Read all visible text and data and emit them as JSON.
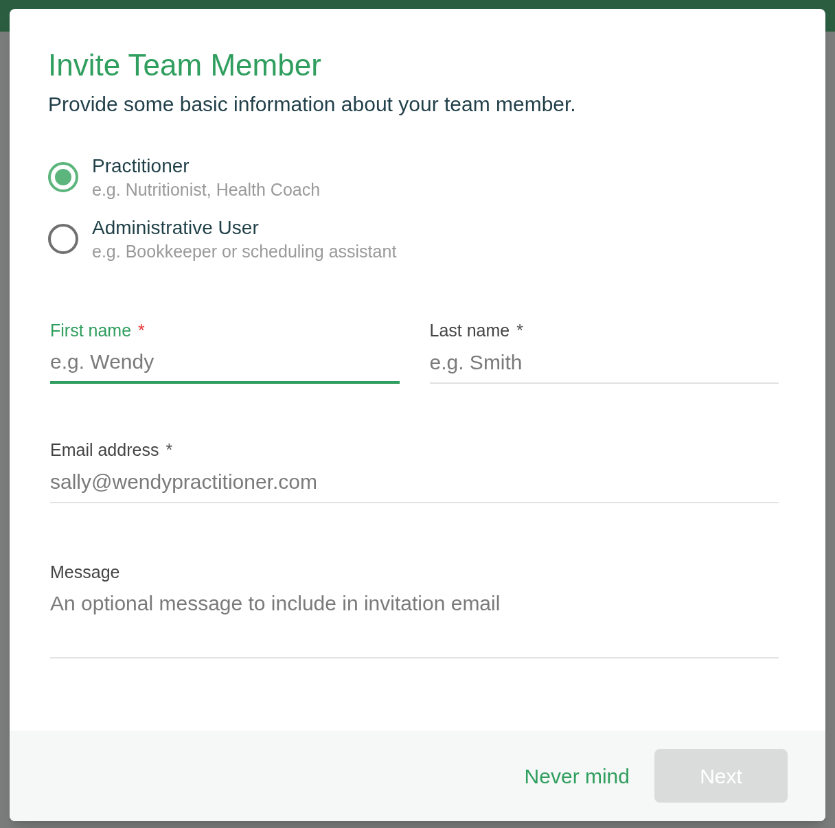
{
  "dialog": {
    "title": "Invite Team Member",
    "subtitle": "Provide some basic information about your team member."
  },
  "roles": [
    {
      "label": "Practitioner",
      "hint": "e.g. Nutritionist, Health Coach",
      "selected": true
    },
    {
      "label": "Administrative User",
      "hint": "e.g. Bookkeeper or scheduling assistant",
      "selected": false
    }
  ],
  "name_fields": [
    {
      "label": "First name",
      "required_mark": "*",
      "placeholder": "e.g. Wendy",
      "focused": true
    },
    {
      "label": "Last name",
      "required_mark": "*",
      "placeholder": "e.g. Smith",
      "focused": false
    }
  ],
  "fields": [
    {
      "kind": "input",
      "label": "Email address",
      "required_mark": "*",
      "placeholder": "sally@wendypractitioner.com",
      "focused": false
    },
    {
      "kind": "textarea",
      "label": "Message",
      "placeholder": "An optional message to include in invitation email",
      "focused": false
    }
  ],
  "footer": {
    "cancel": "Never mind",
    "next": {
      "label": "Next",
      "disabled": true
    }
  }
}
